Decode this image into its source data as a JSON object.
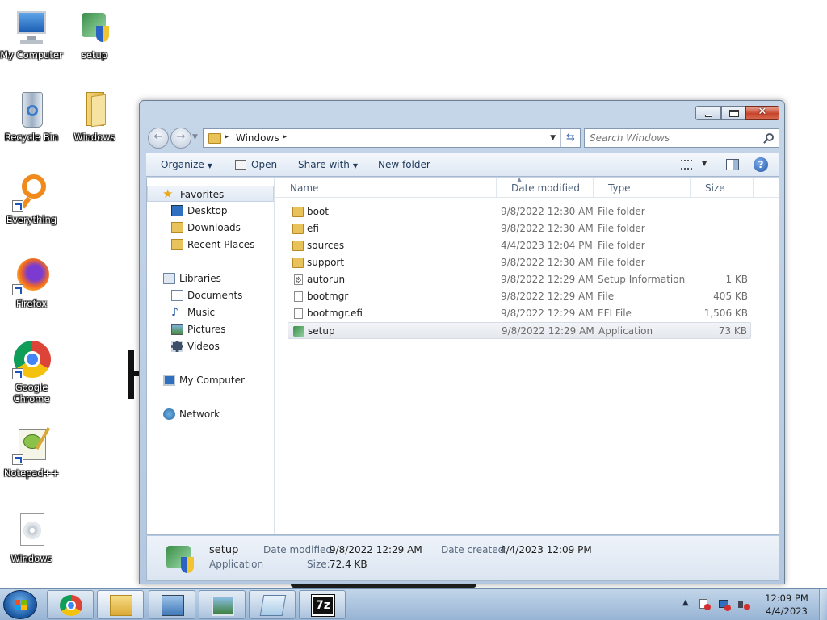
{
  "desktop": {
    "icons": [
      {
        "label": "My Computer"
      },
      {
        "label": "setup"
      },
      {
        "label": "Recycle Bin"
      },
      {
        "label": "Windows"
      },
      {
        "label": "Everything"
      },
      {
        "label": "Firefox"
      },
      {
        "label": "Google Chrome"
      },
      {
        "label": "Notepad++"
      },
      {
        "label": "Windows"
      }
    ]
  },
  "window": {
    "address": {
      "folder": "Windows",
      "separator": "▸"
    },
    "search": {
      "placeholder": "Search Windows"
    },
    "toolbar": {
      "organize": "Organize",
      "open": "Open",
      "share_with": "Share with",
      "new_folder": "New folder"
    },
    "nav": {
      "favorites": "Favorites",
      "desktop": "Desktop",
      "downloads": "Downloads",
      "recent_places": "Recent Places",
      "libraries": "Libraries",
      "documents": "Documents",
      "music": "Music",
      "pictures": "Pictures",
      "videos": "Videos",
      "my_computer": "My Computer",
      "network": "Network"
    },
    "columns": {
      "name": "Name",
      "date": "Date modified",
      "type": "Type",
      "size": "Size"
    },
    "files": [
      {
        "name": "boot",
        "date": "9/8/2022 12:30 AM",
        "type": "File folder",
        "size": "",
        "icon": "folder-icon"
      },
      {
        "name": "efi",
        "date": "9/8/2022 12:30 AM",
        "type": "File folder",
        "size": "",
        "icon": "folder-icon"
      },
      {
        "name": "sources",
        "date": "4/4/2023 12:04 PM",
        "type": "File folder",
        "size": "",
        "icon": "folder-icon"
      },
      {
        "name": "support",
        "date": "9/8/2022 12:30 AM",
        "type": "File folder",
        "size": "",
        "icon": "folder-icon"
      },
      {
        "name": "autorun",
        "date": "9/8/2022 12:29 AM",
        "type": "Setup Information",
        "size": "1 KB",
        "icon": "settings-file-icon"
      },
      {
        "name": "bootmgr",
        "date": "9/8/2022 12:29 AM",
        "type": "File",
        "size": "405 KB",
        "icon": "file-icon"
      },
      {
        "name": "bootmgr.efi",
        "date": "9/8/2022 12:29 AM",
        "type": "EFI File",
        "size": "1,506 KB",
        "icon": "file-icon"
      },
      {
        "name": "setup",
        "date": "9/8/2022 12:29 AM",
        "type": "Application",
        "size": "73 KB",
        "icon": "setup-icon",
        "selected": true
      }
    ],
    "details": {
      "name": "setup",
      "kind": "Application",
      "date_modified_label": "Date modified:",
      "date_modified": "9/8/2022 12:29 AM",
      "size_label": "Size:",
      "size": "72.4 KB",
      "date_created_label": "Date created:",
      "date_created": "4/4/2023 12:09 PM"
    }
  },
  "taskbar": {
    "clock_time": "12:09 PM",
    "clock_date": "4/4/2023",
    "pinned": [
      "chrome-icon",
      "explorer-icon",
      "control-panel-icon",
      "photo-viewer-icon",
      "notepad-icon",
      "7zip-icon"
    ],
    "sevenzip_label": "7z"
  }
}
